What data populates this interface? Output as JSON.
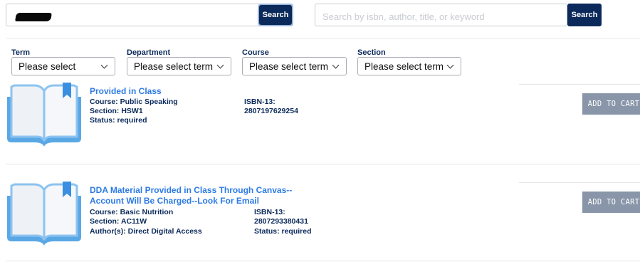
{
  "search": {
    "primary_value": "",
    "primary_button": "Search",
    "secondary_placeholder": "Search by isbn, author, title, or keyword",
    "secondary_button": "Search"
  },
  "filters": {
    "term": {
      "label": "Term",
      "value": "Please select"
    },
    "department": {
      "label": "Department",
      "value": "Please select term"
    },
    "course": {
      "label": "Course",
      "value": "Please select term"
    },
    "section": {
      "label": "Section",
      "value": "Please select term"
    }
  },
  "items": [
    {
      "title_lines": [
        "Provided in Class"
      ],
      "course": "Course: Public Speaking",
      "section": "Section: HSW1",
      "status": "Status: required",
      "isbn_label": "ISBN-13:",
      "isbn": "2807197629254",
      "button": "ADD TO CART"
    },
    {
      "title_lines": [
        "DDA Material Provided in Class Through Canvas--",
        "Account Will Be Charged--Look For Email"
      ],
      "course": "Course: Basic Nutrition",
      "section": "Section: AC11W",
      "authors": "Author(s): Direct Digital Access",
      "isbn_label": "ISBN-13:",
      "isbn": "2807293380431",
      "status": "Status: required",
      "button": "ADD TO CART"
    }
  ],
  "colors": {
    "navy": "#0b2a5b",
    "link_blue": "#2c7be5",
    "button_gray": "#8996a9",
    "book_blue": "#5aa7e6"
  },
  "icons": {
    "book": "open-book-icon",
    "chevron": "chevron-down-icon"
  }
}
